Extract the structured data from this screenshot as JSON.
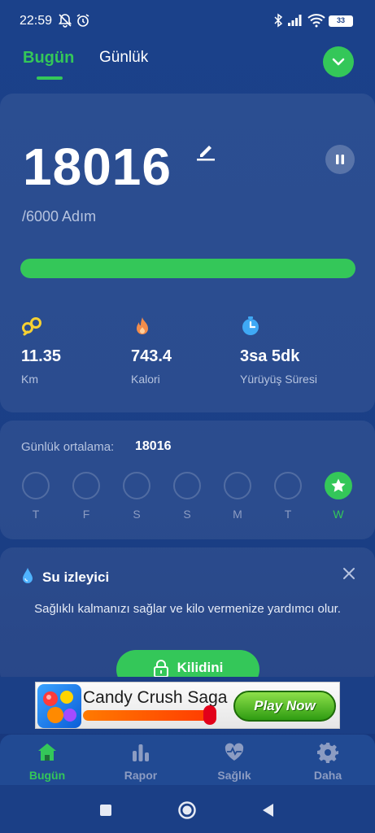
{
  "status_bar": {
    "time": "22:59",
    "battery": "33",
    "icons": [
      "mute-notifications-icon",
      "alarm-icon",
      "bluetooth-icon",
      "signal-icon",
      "wifi-icon",
      "battery-icon"
    ]
  },
  "tabs": [
    {
      "label": "Bugün",
      "active": true
    },
    {
      "label": "Günlük",
      "active": false
    }
  ],
  "steps": {
    "value": "18016",
    "goal": "/6000 Adım",
    "progress_fraction": 1.0
  },
  "stats": [
    {
      "icon": "distance-icon",
      "value": "11.35",
      "label": "Km"
    },
    {
      "icon": "fire-icon",
      "value": "743.4",
      "label": "Kalori"
    },
    {
      "icon": "timer-icon",
      "value": "3sa 5dk",
      "label": "Yürüyüş Süresi"
    }
  ],
  "weekly": {
    "avg_label": "Günlük ortalama:",
    "avg_value": "18016",
    "days": [
      "T",
      "F",
      "S",
      "S",
      "M",
      "T",
      "W"
    ],
    "active_index": 6
  },
  "water": {
    "title": "Su izleyici",
    "description": "Sağlıklı kalmanızı sağlar ve kilo vermenize yardımcı olur.",
    "button_label": "Kilidini"
  },
  "ad": {
    "title": "Candy Crush Saga",
    "cta": "Play Now"
  },
  "bottom_nav": [
    {
      "label": "Bugün",
      "icon": "home-icon",
      "active": true
    },
    {
      "label": "Rapor",
      "icon": "bar-chart-icon",
      "active": false
    },
    {
      "label": "Sağlık",
      "icon": "heart-pulse-icon",
      "active": false
    },
    {
      "label": "Daha",
      "icon": "gear-icon",
      "active": false
    }
  ],
  "colors": {
    "accent": "#34c759",
    "background": "#1b418a",
    "muted_text": "#b6c3df"
  }
}
